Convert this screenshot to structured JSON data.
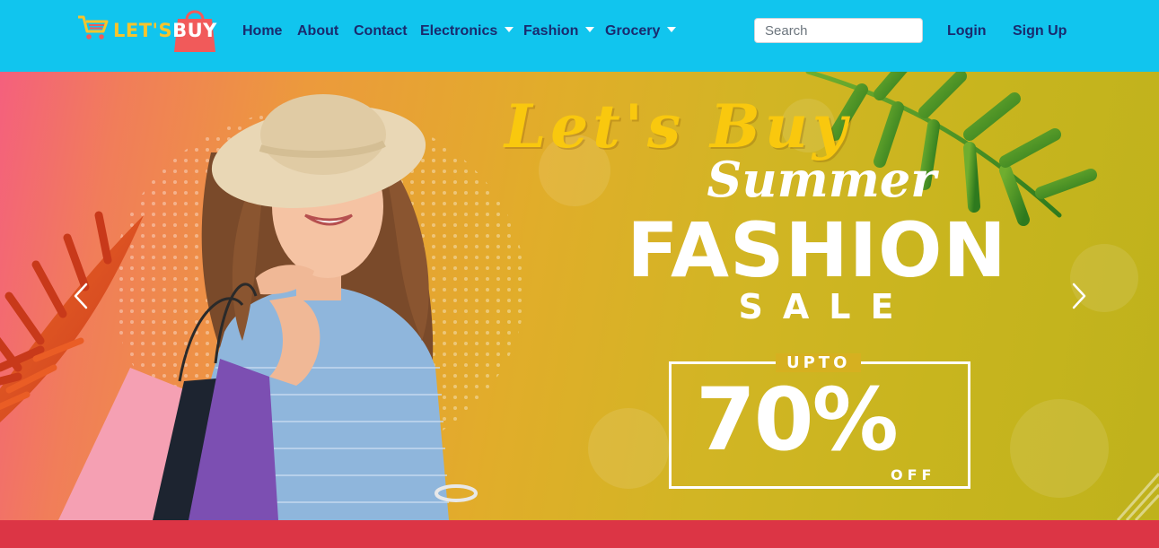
{
  "brand": {
    "name_part1": "LET'S",
    "name_part2": "BUY",
    "colors": {
      "navbar": "#11c5ee",
      "nav_text": "#1a2b6e",
      "logo_yellow": "#f7c42c",
      "logo_red": "#f15a5a"
    }
  },
  "nav": {
    "home": "Home",
    "about": "About",
    "contact": "Contact",
    "electronics": "Electronics",
    "fashion": "Fashion",
    "grocery": "Grocery"
  },
  "search": {
    "placeholder": "Search",
    "value": ""
  },
  "auth": {
    "login": "Login",
    "signup": "Sign Up"
  },
  "hero": {
    "line1": "Let's Buy",
    "line2": "Summer",
    "line3": "FASHION",
    "line4": "SALE",
    "upto": "UPTO",
    "discount": "70%",
    "off": "OFF",
    "prev_icon": "chevron-left-icon",
    "next_icon": "chevron-right-icon"
  },
  "footer_strip": {
    "color": "#dc3545"
  }
}
